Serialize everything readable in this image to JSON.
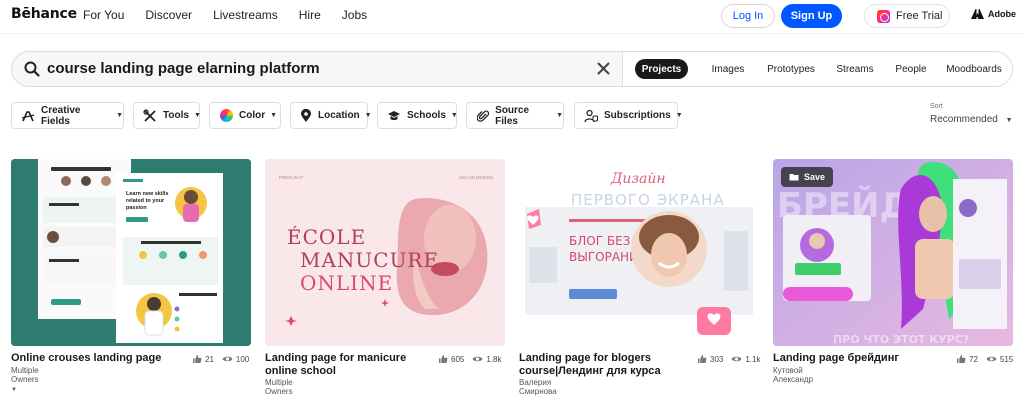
{
  "nav": {
    "logo": "Bēhance",
    "links": [
      "For You",
      "Discover",
      "Livestreams",
      "Hire",
      "Jobs"
    ],
    "login": "Log In",
    "signup": "Sign Up",
    "trial": "Free Trial",
    "adobe": "Adobe"
  },
  "search": {
    "query": "course landing page elarning platform",
    "tabs": [
      "Projects",
      "Images",
      "Prototypes",
      "Streams",
      "People",
      "Moodboards"
    ],
    "active_tab": "Projects"
  },
  "filters": [
    "Creative Fields",
    "Tools",
    "Color",
    "Location",
    "Schools",
    "Source Files",
    "Subscriptions"
  ],
  "sort": {
    "label": "Sort",
    "value": "Recommended"
  },
  "cards": [
    {
      "title": "Online crouses landing page",
      "owner": "Multiple Owners",
      "likes": "21",
      "views": "100"
    },
    {
      "title": "Landing page for manicure online school",
      "owner": "Multiple Owners",
      "likes": "605",
      "views": "1.8k"
    },
    {
      "title": "Landing page for blogers course|Лендинг для курса",
      "owner": "Валерия Смирнова",
      "likes": "303",
      "views": "1.1k"
    },
    {
      "title": "Landing page брейдинг",
      "owner": "Кутовой Александр",
      "likes": "72",
      "views": "515"
    }
  ],
  "thumb_text": {
    "manicure_main": "ÉCOLE MANUCURE ONLINE",
    "blog_script": "Дизайн",
    "blog_headline": "ПЕРВОГО ЭКРАНА",
    "blog_sub": "БЛОГ БЕЗ ВЫГОРАНИЯ",
    "braid_top": "БРЕЙДЫ",
    "braid_bottom": "ПРО ЧТО ЭТОТ КУРС?",
    "learn_heading": "Learn new skills related to your passion",
    "save": "Save"
  },
  "colors": {
    "accent": "#0057ff"
  }
}
